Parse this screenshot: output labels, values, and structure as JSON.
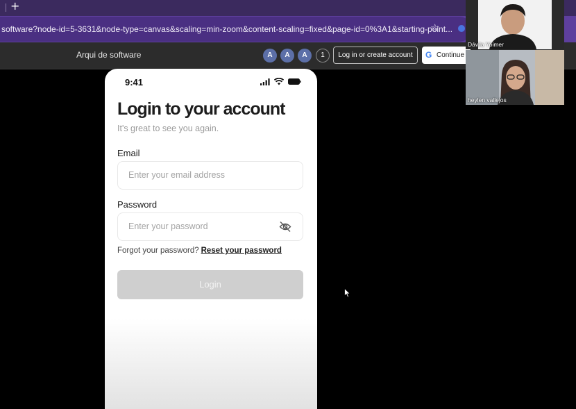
{
  "browser": {
    "new_tab_label": "+",
    "url": "software?node-id=5-3631&node-type=canvas&scaling=min-zoom&content-scaling=fixed&page-id=0%3A1&starting-point...",
    "bookmark_icon": "star-icon"
  },
  "figma": {
    "file_name": "Arqui de software",
    "avatars": [
      "A",
      "A",
      "A"
    ],
    "viewer_count": "1",
    "login_label": "Log in or create account",
    "google_label": "Continue w",
    "google_icon": "G"
  },
  "phone": {
    "time": "9:41",
    "title": "Login to your account",
    "subtitle": "It's great to see you again.",
    "email_label": "Email",
    "email_placeholder": "Enter your email address",
    "password_label": "Password",
    "password_placeholder": "Enter your password",
    "forgot_text": "Forgot your password?",
    "reset_link": "Reset your password",
    "login_button": "Login"
  },
  "participants": [
    {
      "name": "Dávila Yoimer"
    },
    {
      "name": "heylen vallejos"
    }
  ],
  "colors": {
    "tab_bar": "#3b2a5e",
    "address_bar": "#5e3f9e",
    "figma_bar": "#2c2c2c",
    "avatar": "#5c6fa8",
    "login_button_disabled": "#cfcfcf"
  }
}
